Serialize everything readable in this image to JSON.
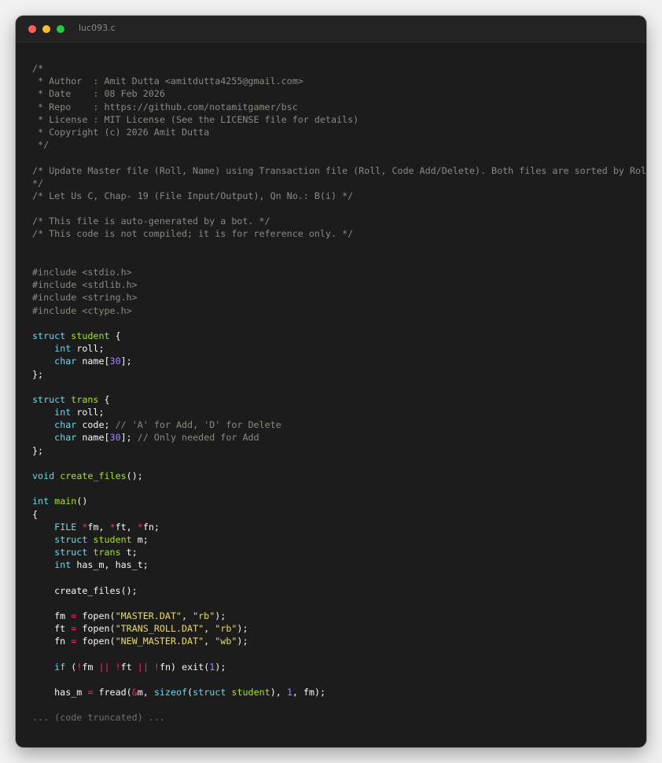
{
  "window": {
    "title": "luc093.c",
    "controls": {
      "close_color": "#ff5f57",
      "minimize_color": "#febc2e",
      "maximize_color": "#28c840"
    }
  },
  "theme": {
    "background": "#1c1c1c",
    "default": "#f8f8f2",
    "comment": "#8a8a80",
    "keyword": "#66d9ef",
    "type_name": "#a6e22e",
    "operator": "#f92672",
    "string": "#e6db74",
    "number": "#ae81ff",
    "truncated": "#6f6f6f"
  },
  "code_lines": [
    [
      [
        "comment",
        "/*"
      ]
    ],
    [
      [
        "comment",
        " * Author  : Amit Dutta <amitdutta4255@gmail.com>"
      ]
    ],
    [
      [
        "comment",
        " * Date    : 08 Feb 2026"
      ]
    ],
    [
      [
        "comment",
        " * Repo    : https://github.com/notamitgamer/bsc"
      ]
    ],
    [
      [
        "comment",
        " * License : MIT License (See the LICENSE file for details)"
      ]
    ],
    [
      [
        "comment",
        " * Copyright (c) 2026 Amit Dutta"
      ]
    ],
    [
      [
        "comment",
        " */"
      ]
    ],
    [],
    [
      [
        "comment",
        "/* Update Master file (Roll, Name) using Transaction file (Roll, Code Add/Delete). Both files are sorted by Roll"
      ]
    ],
    [
      [
        "comment",
        "*/"
      ]
    ],
    [
      [
        "comment",
        "/* Let Us C, Chap- 19 (File Input/Output), Qn No.: B(i) */"
      ]
    ],
    [],
    [
      [
        "comment",
        "/* This file is auto-generated by a bot. */"
      ]
    ],
    [
      [
        "comment",
        "/* This code is not compiled; it is for reference only. */"
      ]
    ],
    [],
    [],
    [
      [
        "comment",
        "#include <stdio.h>"
      ]
    ],
    [
      [
        "comment",
        "#include <stdlib.h>"
      ]
    ],
    [
      [
        "comment",
        "#include <string.h>"
      ]
    ],
    [
      [
        "comment",
        "#include <ctype.h>"
      ]
    ],
    [],
    [
      [
        "keyword",
        "struct"
      ],
      [
        "default",
        " "
      ],
      [
        "type_name",
        "student"
      ],
      [
        "default",
        " {"
      ]
    ],
    [
      [
        "default",
        "    "
      ],
      [
        "keyword",
        "int"
      ],
      [
        "default",
        " roll;"
      ]
    ],
    [
      [
        "default",
        "    "
      ],
      [
        "keyword",
        "char"
      ],
      [
        "default",
        " name["
      ],
      [
        "number",
        "30"
      ],
      [
        "default",
        "];"
      ]
    ],
    [
      [
        "default",
        "};"
      ]
    ],
    [],
    [
      [
        "keyword",
        "struct"
      ],
      [
        "default",
        " "
      ],
      [
        "type_name",
        "trans"
      ],
      [
        "default",
        " {"
      ]
    ],
    [
      [
        "default",
        "    "
      ],
      [
        "keyword",
        "int"
      ],
      [
        "default",
        " roll;"
      ]
    ],
    [
      [
        "default",
        "    "
      ],
      [
        "keyword",
        "char"
      ],
      [
        "default",
        " code; "
      ],
      [
        "comment",
        "// 'A' for Add, 'D' for Delete"
      ]
    ],
    [
      [
        "default",
        "    "
      ],
      [
        "keyword",
        "char"
      ],
      [
        "default",
        " name["
      ],
      [
        "number",
        "30"
      ],
      [
        "default",
        "]; "
      ],
      [
        "comment",
        "// Only needed for Add"
      ]
    ],
    [
      [
        "default",
        "};"
      ]
    ],
    [],
    [
      [
        "keyword",
        "void"
      ],
      [
        "default",
        " "
      ],
      [
        "type_name",
        "create_files"
      ],
      [
        "default",
        "();"
      ]
    ],
    [],
    [
      [
        "keyword",
        "int"
      ],
      [
        "default",
        " "
      ],
      [
        "type_name",
        "main"
      ],
      [
        "default",
        "()"
      ]
    ],
    [
      [
        "default",
        "{"
      ]
    ],
    [
      [
        "default",
        "    "
      ],
      [
        "keyword",
        "FILE"
      ],
      [
        "default",
        " "
      ],
      [
        "operator",
        "*"
      ],
      [
        "default",
        "fm, "
      ],
      [
        "operator",
        "*"
      ],
      [
        "default",
        "ft, "
      ],
      [
        "operator",
        "*"
      ],
      [
        "default",
        "fn;"
      ]
    ],
    [
      [
        "default",
        "    "
      ],
      [
        "keyword",
        "struct"
      ],
      [
        "default",
        " "
      ],
      [
        "type_name",
        "student"
      ],
      [
        "default",
        " m;"
      ]
    ],
    [
      [
        "default",
        "    "
      ],
      [
        "keyword",
        "struct"
      ],
      [
        "default",
        " "
      ],
      [
        "type_name",
        "trans"
      ],
      [
        "default",
        " t;"
      ]
    ],
    [
      [
        "default",
        "    "
      ],
      [
        "keyword",
        "int"
      ],
      [
        "default",
        " has_m, has_t;"
      ]
    ],
    [],
    [
      [
        "default",
        "    create_files();"
      ]
    ],
    [],
    [
      [
        "default",
        "    fm "
      ],
      [
        "operator",
        "="
      ],
      [
        "default",
        " fopen("
      ],
      [
        "string",
        "\"MASTER.DAT\""
      ],
      [
        "default",
        ", "
      ],
      [
        "string",
        "\"rb\""
      ],
      [
        "default",
        ");"
      ]
    ],
    [
      [
        "default",
        "    ft "
      ],
      [
        "operator",
        "="
      ],
      [
        "default",
        " fopen("
      ],
      [
        "string",
        "\"TRANS_ROLL.DAT\""
      ],
      [
        "default",
        ", "
      ],
      [
        "string",
        "\"rb\""
      ],
      [
        "default",
        ");"
      ]
    ],
    [
      [
        "default",
        "    fn "
      ],
      [
        "operator",
        "="
      ],
      [
        "default",
        " fopen("
      ],
      [
        "string",
        "\"NEW_MASTER.DAT\""
      ],
      [
        "default",
        ", "
      ],
      [
        "string",
        "\"wb\""
      ],
      [
        "default",
        ");"
      ]
    ],
    [],
    [
      [
        "default",
        "    "
      ],
      [
        "keyword",
        "if"
      ],
      [
        "default",
        " ("
      ],
      [
        "operator",
        "!"
      ],
      [
        "default",
        "fm "
      ],
      [
        "operator",
        "||"
      ],
      [
        "default",
        " "
      ],
      [
        "operator",
        "!"
      ],
      [
        "default",
        "ft "
      ],
      [
        "operator",
        "||"
      ],
      [
        "default",
        " "
      ],
      [
        "operator",
        "!"
      ],
      [
        "default",
        "fn) exit("
      ],
      [
        "number",
        "1"
      ],
      [
        "default",
        ");"
      ]
    ],
    [],
    [
      [
        "default",
        "    has_m "
      ],
      [
        "operator",
        "="
      ],
      [
        "default",
        " fread("
      ],
      [
        "operator",
        "&"
      ],
      [
        "default",
        "m, "
      ],
      [
        "keyword",
        "sizeof"
      ],
      [
        "default",
        "("
      ],
      [
        "keyword",
        "struct"
      ],
      [
        "default",
        " "
      ],
      [
        "type_name",
        "student"
      ],
      [
        "default",
        "), "
      ],
      [
        "number",
        "1"
      ],
      [
        "default",
        ", fm);"
      ]
    ]
  ],
  "truncated_note": "... (code truncated) ..."
}
